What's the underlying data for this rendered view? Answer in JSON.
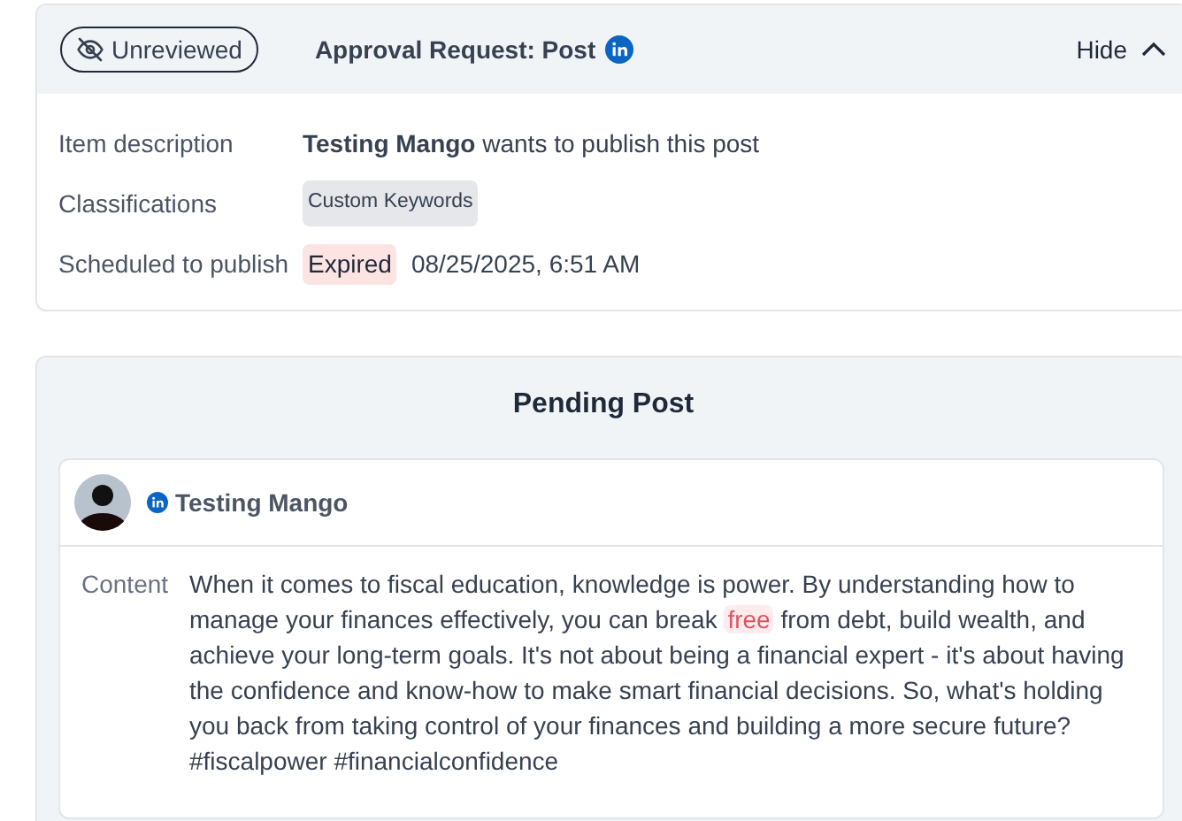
{
  "request": {
    "status_badge": "Unreviewed",
    "title": "Approval Request: Post",
    "toggle": "Hide",
    "expanded": true,
    "fields": [
      {
        "kind": "text",
        "label": "Item description",
        "name": "Testing Mango",
        "text": "wants to publish this post"
      },
      {
        "kind": "tag",
        "label": "Classifications",
        "tag": "Custom Keywords"
      },
      {
        "kind": "schedule",
        "label": "Scheduled to publish",
        "status": "Expired",
        "date": "08/25/2025, 6:51 AM"
      }
    ]
  },
  "pending_post": {
    "title": "Pending Post",
    "author": "Testing Mango",
    "content_label": "Content",
    "content": [
      {
        "text": "When it comes to fiscal education, knowledge is power. By understanding how to manage your finances effectively, you can break ",
        "flagged": false
      },
      {
        "text": "free",
        "flagged": true
      },
      {
        "text": " from debt, build wealth, and achieve your long-term goals. It's not about being a financial expert - it's about having the confidence and know-how to make smart financial decisions. So, what's holding you back from taking control of your finances and building a more secure future? #fiscalpower #financialconfidence",
        "flagged": false
      }
    ]
  }
}
